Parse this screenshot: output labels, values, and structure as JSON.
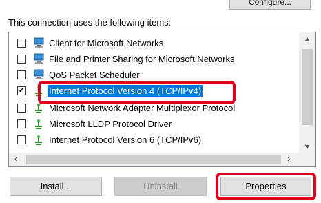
{
  "top_button": {
    "label": "Configure..."
  },
  "heading": "This connection uses the following items:",
  "items": [
    {
      "label": "Client for Microsoft Networks",
      "checked": false,
      "icon": "network-client-icon"
    },
    {
      "label": "File and Printer Sharing for Microsoft Networks",
      "checked": false,
      "icon": "network-service-icon"
    },
    {
      "label": "QoS Packet Scheduler",
      "checked": false,
      "icon": "network-service-icon"
    },
    {
      "label": "Internet Protocol Version 4 (TCP/IPv4)",
      "checked": true,
      "selected": true,
      "icon": "protocol-icon"
    },
    {
      "label": "Microsoft Network Adapter Multiplexor Protocol",
      "checked": false,
      "icon": "protocol-icon"
    },
    {
      "label": "Microsoft LLDP Protocol Driver",
      "checked": false,
      "icon": "protocol-icon"
    },
    {
      "label": "Internet Protocol Version 6 (TCP/IPv6)",
      "checked": false,
      "icon": "protocol-icon"
    }
  ],
  "buttons": {
    "install": "Install...",
    "uninstall": "Uninstall",
    "properties": "Properties"
  },
  "colors": {
    "selection": "#0078d7",
    "highlight_box": "#e0001b"
  }
}
